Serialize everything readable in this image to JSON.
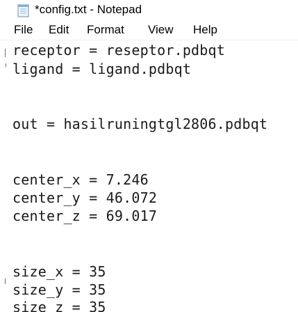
{
  "window": {
    "title": "*config.txt - Notepad"
  },
  "menu": {
    "file": "File",
    "edit": "Edit",
    "format": "Format",
    "view": "View",
    "help": "Help"
  },
  "editor": {
    "lines": [
      "receptor = reseptor.pdbqt",
      "ligand = ligand.pdbqt",
      "out = hasilruningtgl2806.pdbqt",
      "center_x = 7.246",
      "center_y = 46.072",
      "center_z = 69.017",
      "size_x = 35",
      "size_y = 35",
      "size_z = 35"
    ]
  }
}
